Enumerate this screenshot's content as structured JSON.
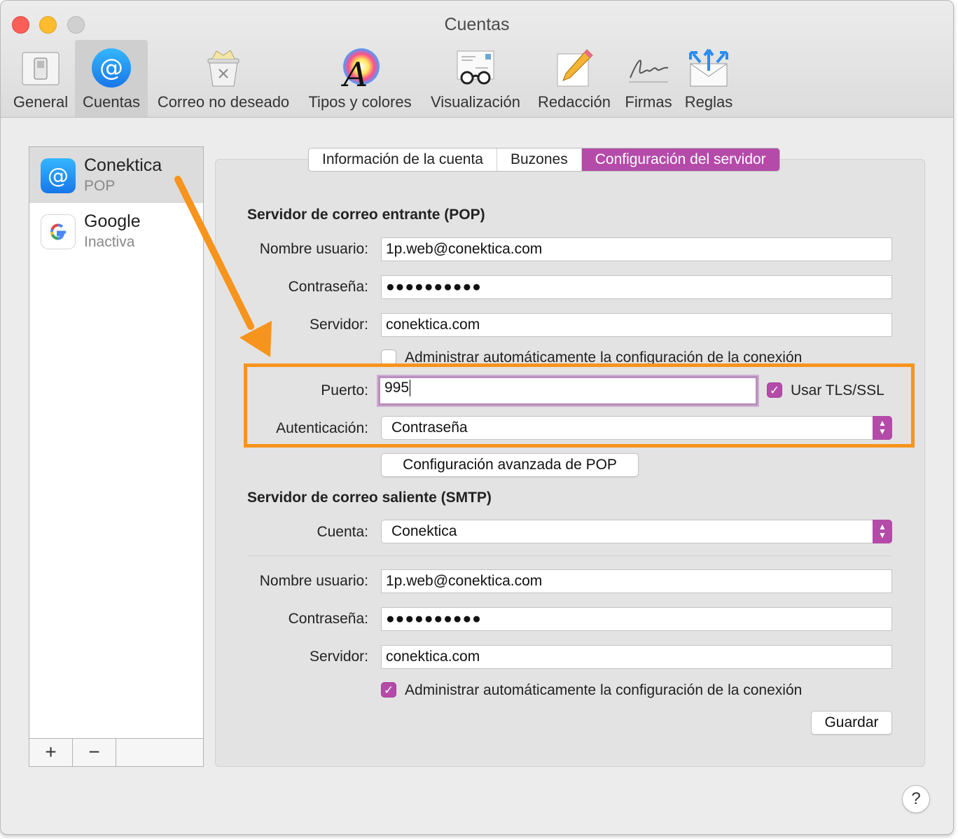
{
  "window": {
    "title": "Cuentas"
  },
  "toolbar": {
    "items": [
      {
        "label": "General",
        "icon": "switch-icon"
      },
      {
        "label": "Cuentas",
        "icon": "at-icon"
      },
      {
        "label": "Correo no deseado",
        "icon": "trash-junk-icon"
      },
      {
        "label": "Tipos y colores",
        "icon": "font-color-icon"
      },
      {
        "label": "Visualización",
        "icon": "glasses-icon"
      },
      {
        "label": "Redacción",
        "icon": "pencil-icon"
      },
      {
        "label": "Firmas",
        "icon": "signature-icon"
      },
      {
        "label": "Reglas",
        "icon": "envelope-arrows-icon"
      }
    ],
    "active": "Cuentas"
  },
  "sidebar": {
    "accounts": [
      {
        "name": "Conektica",
        "status": "POP",
        "icon": "at-icon",
        "selected": true
      },
      {
        "name": "Google",
        "status": "Inactiva",
        "icon": "google-icon",
        "selected": false
      }
    ],
    "add_label": "+",
    "remove_label": "−"
  },
  "tabs": {
    "items": [
      "Información de la cuenta",
      "Buzones",
      "Configuración del servidor"
    ],
    "active": "Configuración del servidor"
  },
  "incoming": {
    "title": "Servidor de correo entrante (POP)",
    "username_label": "Nombre usuario:",
    "username": "1p.web@conektica.com",
    "password_label": "Contraseña:",
    "password": "●●●●●●●●●●",
    "server_label": "Servidor:",
    "server": "conektica.com",
    "auto_manage_label": "Administrar automáticamente la configuración de la conexión",
    "auto_manage": false,
    "port_label": "Puerto:",
    "port": "995",
    "tls_label": "Usar TLS/SSL",
    "tls": true,
    "auth_label": "Autenticación:",
    "auth": "Contraseña",
    "advanced_button": "Configuración avanzada de POP"
  },
  "outgoing": {
    "title": "Servidor de correo saliente (SMTP)",
    "account_label": "Cuenta:",
    "account": "Conektica",
    "username_label": "Nombre usuario:",
    "username": "1p.web@conektica.com",
    "password_label": "Contraseña:",
    "password": "●●●●●●●●●●",
    "server_label": "Servidor:",
    "server": "conektica.com",
    "auto_manage_label": "Administrar automáticamente la configuración de la conexión",
    "auto_manage": true
  },
  "save_button": "Guardar",
  "help_label": "?",
  "colors": {
    "accent": "#b44ba9",
    "annotation": "#f7941d"
  }
}
